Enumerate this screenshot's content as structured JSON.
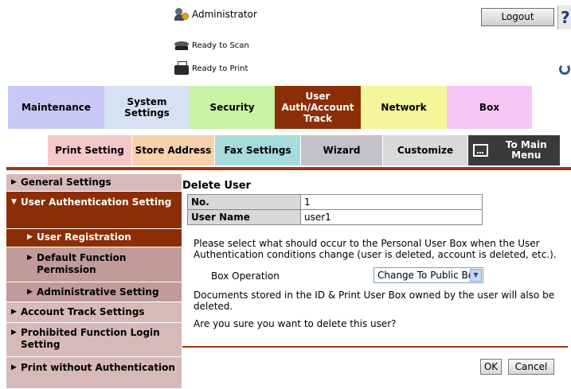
{
  "header": {
    "user_label": "Administrator",
    "logout_label": "Logout",
    "help_label": "?",
    "scan_status": "Ready to Scan",
    "print_status": "Ready to Print"
  },
  "main_tabs": [
    {
      "label": "Maintenance",
      "color": "#c8c8f5"
    },
    {
      "label": "System Settings",
      "color": "#d6e2f2"
    },
    {
      "label": "Security",
      "color": "#c9f2a5"
    },
    {
      "label": "User Auth/Account Track",
      "color": "#8b2e05",
      "active": true
    },
    {
      "label": "Network",
      "color": "#f5f59a"
    },
    {
      "label": "Box",
      "color": "#f5c6f5"
    }
  ],
  "sub_tabs": [
    {
      "label": "Print Setting",
      "color": "#f5c8c8"
    },
    {
      "label": "Store Address",
      "color": "#f8d2ad"
    },
    {
      "label": "Fax Settings",
      "color": "#a8dcdc"
    },
    {
      "label": "Wizard",
      "color": "#c4c0c8"
    },
    {
      "label": "Customize",
      "color": "#d9d9d9"
    },
    {
      "label": "To Main Menu",
      "color": "#3a3a3a"
    }
  ],
  "sidebar": {
    "items": [
      {
        "label": "General Settings"
      },
      {
        "label": "User Authentication Setting"
      },
      {
        "label": "User Registration"
      },
      {
        "label": "Default Function Permission"
      },
      {
        "label": "Administrative Setting"
      },
      {
        "label": "Account Track Settings"
      },
      {
        "label": "Prohibited Function Login Setting"
      },
      {
        "label": "Print without Authentication"
      }
    ]
  },
  "content": {
    "title": "Delete User",
    "table": [
      {
        "key": "No.",
        "value": "1"
      },
      {
        "key": "User Name",
        "value": "user1"
      }
    ],
    "message1": "Please select what should occur to the Personal User Box when the User Authentication conditions change (user is deleted, account is deleted, etc.).",
    "box_operation_label": "Box Operation",
    "box_operation_value": "Change To Public Box",
    "message2": "Documents stored in the ID & Print User Box owned by the user will also be deleted.",
    "message3": "Are you sure you want to delete this user?",
    "ok_label": "OK",
    "cancel_label": "Cancel"
  }
}
